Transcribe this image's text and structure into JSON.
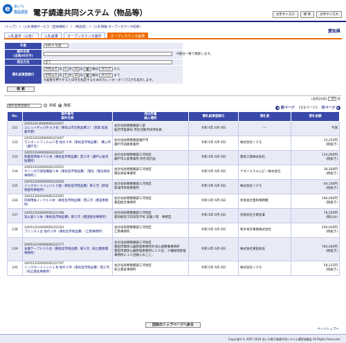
{
  "header": {
    "logo_top": "あいち",
    "logo_bottom": "物品調達",
    "system_title": "電子調達共同システム（物品等）",
    "font_buttons": [
      "文字サイズ小",
      "標 準",
      "文字サイズ大"
    ]
  },
  "breadcrumb": {
    "trail": "〔トップ〕＞〔入札情報サービス（団体選択）〕＞〔物品等〕＞〔入札情報-オープンカウンタ結果〕"
  },
  "prefecture": "愛知県",
  "tabs": [
    "入札案件（公告）",
    "入札結果",
    "オープンカウンタ案件",
    "オープンカウンタ結果"
  ],
  "conditions": {
    "year_label": "年度",
    "year_value": "令和 6 年度",
    "case_label": "案件名称\n(全角30文字)",
    "case_note": "※部分一致で検索します。",
    "proc_label": "発注方法",
    "proc_value": "全て",
    "date_label": "開札結果登録日",
    "era": "令和",
    "y1": "6",
    "m1": "6",
    "d1": "20",
    "y2": "6",
    "m2": "9",
    "d2": "20",
    "cal": "曜日",
    "clear": "クリア",
    "kara": "から",
    "made": "まで",
    "nen": "年",
    "gatsu": "月",
    "nichi": "日",
    "calendar_note": "※画像を押下すると日付を指定するためのカレンダーダイアログを表示します。"
  },
  "search_button": "検 索",
  "sort": {
    "select": "開札結果登録日",
    "asc": "昇順",
    "desc": "降順"
  },
  "pager": {
    "count": "(全件20件)",
    "per_page": "20",
    "per_page_unit": "件",
    "prev": "前ページ",
    "page_info": "(1/1ページ)",
    "next": "次ページ"
  },
  "table": {
    "headers": [
      "No.",
      "案件番号\n案件名称",
      "発注所属\n納入場所",
      "開札結果登録日",
      "落札者",
      "落札金額"
    ],
    "rows": [
      {
        "no": "231",
        "num": "24052413000006221057",
        "name": "ユニットサッパチョ３号（東松山市北物品費２）（蛍発 岐遠藤市野）",
        "dept": "会計局財務整備部５部\n稲沢市医療局 市民活動市民所係員",
        "date": "令和 6年 6月 6日",
        "winner": "---",
        "amt": "不調"
      },
      {
        "no": "232",
        "num": "24052416000006221007",
        "name": "ラミネートフィルム５巻 他の３件〈東松島市物品費〉　購入所（瀬戸吉）",
        "dept": "会計局財務整備部瀬戸市\n瀬戸市道路事業所",
        "date": "令和 6年 6月 6日",
        "winner": "株式会社イクモ",
        "amt": "13,250円\n(税抜き)"
      },
      {
        "no": "233",
        "num": "24052319000006222147",
        "name": "階層基準線４５０本〈東松島市物品費〉西三河（瀬戸公安消防署所）",
        "dept": "会計局財務整備部三河地区\n瀬戸市公安事業所 所在地計画",
        "date": "令和 6年 6月 6日",
        "winner": "豊栄工業株式会社",
        "amt": "114,000円\n(税抜き)"
      },
      {
        "no": "234",
        "num": "24052416000006222052",
        "name": "サイン付き調査機器２本〈東松島市物品費〉（電気（電気保安事務所））",
        "dept": "会計局財務整備部三河地区\n電気保安事業所",
        "date": "令和 6年 6月 6日",
        "winner": "ナガイエスエムピー株式会社",
        "amt": "38,268円\n(税抜き)"
      },
      {
        "no": "235",
        "num": "24052326000006222036",
        "name": "インクカートリッジ１０個〈東松島市物品費〉東三河（新城東部県事務所）",
        "dept": "会計局財務整備部三河地区\n新城市県税事務所",
        "date": "令和 6年 6月 6日",
        "winner": "株式会社イクモ",
        "amt": "64,100円\n(税抜き)"
      },
      {
        "no": "236",
        "num": "24052326000006222005",
        "name": "印刷用紙インク６０本〈東松島市物品費〉西三河（豊田事務所）",
        "dept": "会計局財務整備部三河地区\n豊田総合事務所",
        "date": "令和 6年 6月 6日",
        "winner": "有限会社豊和事務機",
        "amt": "196,000円\n(税抜き)"
      },
      {
        "no": "237",
        "num": "24052316000006221198",
        "name": "消火器１０本〈東松島市物品費〉東三河（豊田総合事務所）",
        "dept": "会計局財務整備部三河地区\n愛知総合工科高等学校 実験１階　事務室",
        "date": "令和 6年 6月 6日",
        "winner": "有限会社大東産業",
        "amt": "78,500円\n(税込み)"
      },
      {
        "no": "238",
        "num": "24052314000006222163",
        "name": "プリンタ１台 他の２件〈東松島市物品費〉（江南事務所）",
        "dept": "会計局財務整備部三河地区\n江南事務所",
        "date": "令和 6年 6月 6日",
        "winner": "和幸本店事業株式会社",
        "amt": "200,000円\n(税抜き)"
      },
      {
        "no": "239",
        "num": "24052219000006222177",
        "name": "会議テーブル３０台〈東松島市物品費〉東三河（知立警察署事務所）",
        "dept": "会計局財務整備部三河地区\n豊田市関係公園管理事務所外消火器整備事務所\n豊田市関係公園管理事務所に２０台、小幡緑地管理事務所に１０台納入のこと。",
        "date": "令和 6年 6月 6日",
        "winner": "株式会社東田商会",
        "amt": "780,000円\n(税抜き)"
      },
      {
        "no": "240",
        "num": "24052319000006221707",
        "name": "インクカートリッジ１本 他の３件〈東松島市物品費〉西三河（知立資産事務所）",
        "dept": "会計局財務整備部三河地区\n知立資産事務所",
        "date": "令和 6年 6月 6日",
        "winner": "株式会社イクモ",
        "amt": "58,225円\n(税抜き)"
      }
    ]
  },
  "bottom_button": "団体のトップページへ戻る",
  "page_top": "ページトップへ",
  "footer": "Copyright © 2007-2024 あいち電子調達共同システム運営協議会 All Rights Reserved."
}
